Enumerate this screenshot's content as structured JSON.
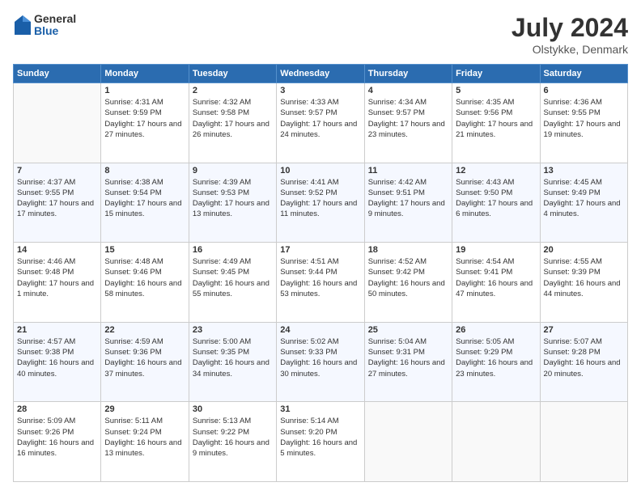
{
  "logo": {
    "general": "General",
    "blue": "Blue"
  },
  "header": {
    "title": "July 2024",
    "subtitle": "Olstykke, Denmark"
  },
  "weekdays": [
    "Sunday",
    "Monday",
    "Tuesday",
    "Wednesday",
    "Thursday",
    "Friday",
    "Saturday"
  ],
  "weeks": [
    [
      {
        "day": "",
        "sunrise": "",
        "sunset": "",
        "daylight": ""
      },
      {
        "day": "1",
        "sunrise": "Sunrise: 4:31 AM",
        "sunset": "Sunset: 9:59 PM",
        "daylight": "Daylight: 17 hours and 27 minutes."
      },
      {
        "day": "2",
        "sunrise": "Sunrise: 4:32 AM",
        "sunset": "Sunset: 9:58 PM",
        "daylight": "Daylight: 17 hours and 26 minutes."
      },
      {
        "day": "3",
        "sunrise": "Sunrise: 4:33 AM",
        "sunset": "Sunset: 9:57 PM",
        "daylight": "Daylight: 17 hours and 24 minutes."
      },
      {
        "day": "4",
        "sunrise": "Sunrise: 4:34 AM",
        "sunset": "Sunset: 9:57 PM",
        "daylight": "Daylight: 17 hours and 23 minutes."
      },
      {
        "day": "5",
        "sunrise": "Sunrise: 4:35 AM",
        "sunset": "Sunset: 9:56 PM",
        "daylight": "Daylight: 17 hours and 21 minutes."
      },
      {
        "day": "6",
        "sunrise": "Sunrise: 4:36 AM",
        "sunset": "Sunset: 9:55 PM",
        "daylight": "Daylight: 17 hours and 19 minutes."
      }
    ],
    [
      {
        "day": "7",
        "sunrise": "Sunrise: 4:37 AM",
        "sunset": "Sunset: 9:55 PM",
        "daylight": "Daylight: 17 hours and 17 minutes."
      },
      {
        "day": "8",
        "sunrise": "Sunrise: 4:38 AM",
        "sunset": "Sunset: 9:54 PM",
        "daylight": "Daylight: 17 hours and 15 minutes."
      },
      {
        "day": "9",
        "sunrise": "Sunrise: 4:39 AM",
        "sunset": "Sunset: 9:53 PM",
        "daylight": "Daylight: 17 hours and 13 minutes."
      },
      {
        "day": "10",
        "sunrise": "Sunrise: 4:41 AM",
        "sunset": "Sunset: 9:52 PM",
        "daylight": "Daylight: 17 hours and 11 minutes."
      },
      {
        "day": "11",
        "sunrise": "Sunrise: 4:42 AM",
        "sunset": "Sunset: 9:51 PM",
        "daylight": "Daylight: 17 hours and 9 minutes."
      },
      {
        "day": "12",
        "sunrise": "Sunrise: 4:43 AM",
        "sunset": "Sunset: 9:50 PM",
        "daylight": "Daylight: 17 hours and 6 minutes."
      },
      {
        "day": "13",
        "sunrise": "Sunrise: 4:45 AM",
        "sunset": "Sunset: 9:49 PM",
        "daylight": "Daylight: 17 hours and 4 minutes."
      }
    ],
    [
      {
        "day": "14",
        "sunrise": "Sunrise: 4:46 AM",
        "sunset": "Sunset: 9:48 PM",
        "daylight": "Daylight: 17 hours and 1 minute."
      },
      {
        "day": "15",
        "sunrise": "Sunrise: 4:48 AM",
        "sunset": "Sunset: 9:46 PM",
        "daylight": "Daylight: 16 hours and 58 minutes."
      },
      {
        "day": "16",
        "sunrise": "Sunrise: 4:49 AM",
        "sunset": "Sunset: 9:45 PM",
        "daylight": "Daylight: 16 hours and 55 minutes."
      },
      {
        "day": "17",
        "sunrise": "Sunrise: 4:51 AM",
        "sunset": "Sunset: 9:44 PM",
        "daylight": "Daylight: 16 hours and 53 minutes."
      },
      {
        "day": "18",
        "sunrise": "Sunrise: 4:52 AM",
        "sunset": "Sunset: 9:42 PM",
        "daylight": "Daylight: 16 hours and 50 minutes."
      },
      {
        "day": "19",
        "sunrise": "Sunrise: 4:54 AM",
        "sunset": "Sunset: 9:41 PM",
        "daylight": "Daylight: 16 hours and 47 minutes."
      },
      {
        "day": "20",
        "sunrise": "Sunrise: 4:55 AM",
        "sunset": "Sunset: 9:39 PM",
        "daylight": "Daylight: 16 hours and 44 minutes."
      }
    ],
    [
      {
        "day": "21",
        "sunrise": "Sunrise: 4:57 AM",
        "sunset": "Sunset: 9:38 PM",
        "daylight": "Daylight: 16 hours and 40 minutes."
      },
      {
        "day": "22",
        "sunrise": "Sunrise: 4:59 AM",
        "sunset": "Sunset: 9:36 PM",
        "daylight": "Daylight: 16 hours and 37 minutes."
      },
      {
        "day": "23",
        "sunrise": "Sunrise: 5:00 AM",
        "sunset": "Sunset: 9:35 PM",
        "daylight": "Daylight: 16 hours and 34 minutes."
      },
      {
        "day": "24",
        "sunrise": "Sunrise: 5:02 AM",
        "sunset": "Sunset: 9:33 PM",
        "daylight": "Daylight: 16 hours and 30 minutes."
      },
      {
        "day": "25",
        "sunrise": "Sunrise: 5:04 AM",
        "sunset": "Sunset: 9:31 PM",
        "daylight": "Daylight: 16 hours and 27 minutes."
      },
      {
        "day": "26",
        "sunrise": "Sunrise: 5:05 AM",
        "sunset": "Sunset: 9:29 PM",
        "daylight": "Daylight: 16 hours and 23 minutes."
      },
      {
        "day": "27",
        "sunrise": "Sunrise: 5:07 AM",
        "sunset": "Sunset: 9:28 PM",
        "daylight": "Daylight: 16 hours and 20 minutes."
      }
    ],
    [
      {
        "day": "28",
        "sunrise": "Sunrise: 5:09 AM",
        "sunset": "Sunset: 9:26 PM",
        "daylight": "Daylight: 16 hours and 16 minutes."
      },
      {
        "day": "29",
        "sunrise": "Sunrise: 5:11 AM",
        "sunset": "Sunset: 9:24 PM",
        "daylight": "Daylight: 16 hours and 13 minutes."
      },
      {
        "day": "30",
        "sunrise": "Sunrise: 5:13 AM",
        "sunset": "Sunset: 9:22 PM",
        "daylight": "Daylight: 16 hours and 9 minutes."
      },
      {
        "day": "31",
        "sunrise": "Sunrise: 5:14 AM",
        "sunset": "Sunset: 9:20 PM",
        "daylight": "Daylight: 16 hours and 5 minutes."
      },
      {
        "day": "",
        "sunrise": "",
        "sunset": "",
        "daylight": ""
      },
      {
        "day": "",
        "sunrise": "",
        "sunset": "",
        "daylight": ""
      },
      {
        "day": "",
        "sunrise": "",
        "sunset": "",
        "daylight": ""
      }
    ]
  ]
}
